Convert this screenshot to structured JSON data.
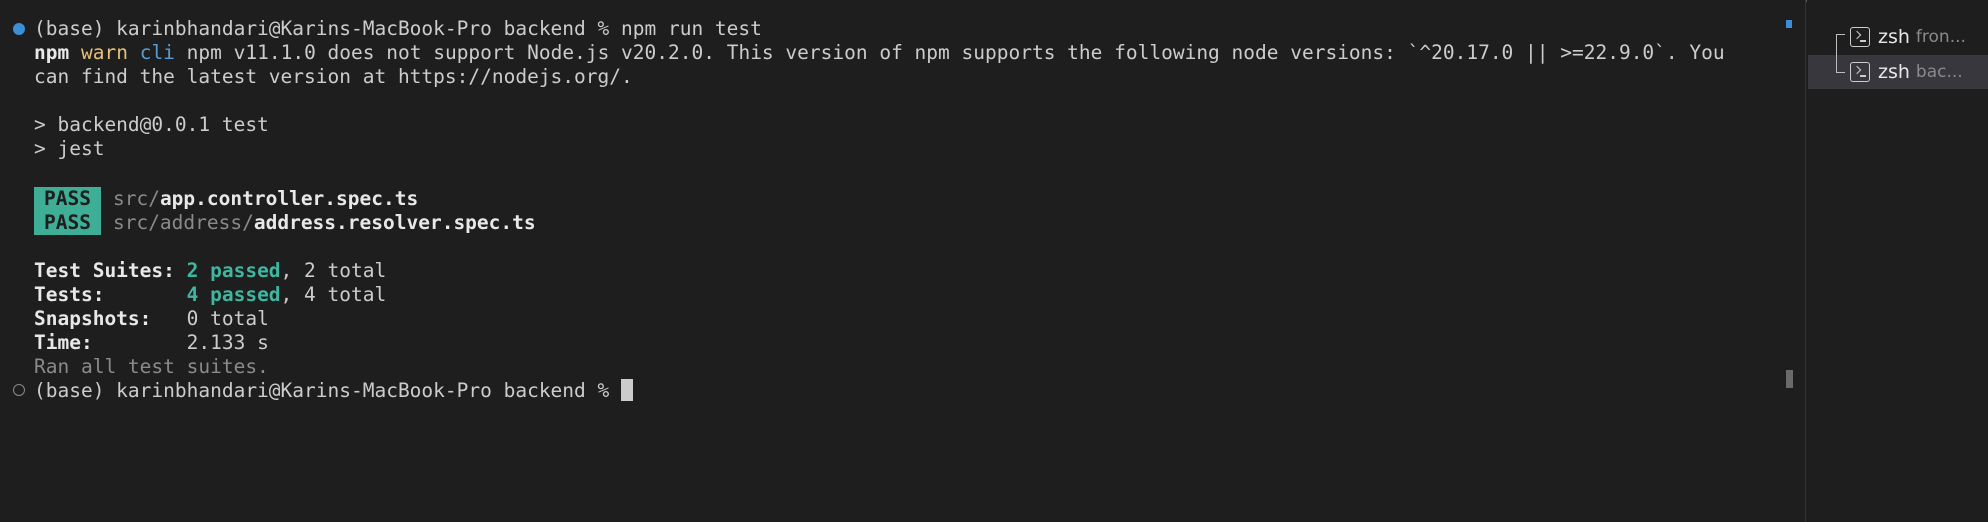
{
  "terminal": {
    "lines": {
      "cmd_prompt": "(base) karinbhandari@Karins-MacBook-Pro backend % ",
      "cmd": "npm run test",
      "warn_npm": "npm",
      "warn_word": "warn",
      "warn_cli": "cli",
      "warn_msg1": " npm v11.1.0 does not support Node.js v20.2.0. This version of npm supports the following node versions: `^20.17.0 || >=22.9.0`. You",
      "warn_msg2": "can find the latest version at https://nodejs.org/.",
      "script_line1": "> backend@0.0.1 test",
      "script_line2": "> jest",
      "pass_label": "PASS",
      "pass1_dir": "src/",
      "pass1_file": "app.controller.spec.ts",
      "pass2_dir": "src/address/",
      "pass2_file": "address.resolver.spec.ts",
      "suites_label": "Test Suites: ",
      "suites_passed": "2 passed",
      "suites_total": ", 2 total",
      "tests_label": "Tests:       ",
      "tests_passed": "4 passed",
      "tests_total": ", 4 total",
      "snapshots_label": "Snapshots:   ",
      "snapshots_value": "0 total",
      "time_label": "Time:        ",
      "time_value": "2.133 s",
      "ran_all": "Ran all test suites.",
      "final_prompt": "(base) karinbhandari@Karins-MacBook-Pro backend % "
    }
  },
  "terminal_list": {
    "items": [
      {
        "name": "zsh",
        "desc": "fron..."
      },
      {
        "name": "zsh",
        "desc": "bac..."
      }
    ]
  },
  "colors": {
    "background": "#1e1e1e",
    "pass_badge": "#3fae96",
    "passed_text": "#3fb6a0",
    "warn": "#e5c07b",
    "cli": "#569cd6"
  }
}
